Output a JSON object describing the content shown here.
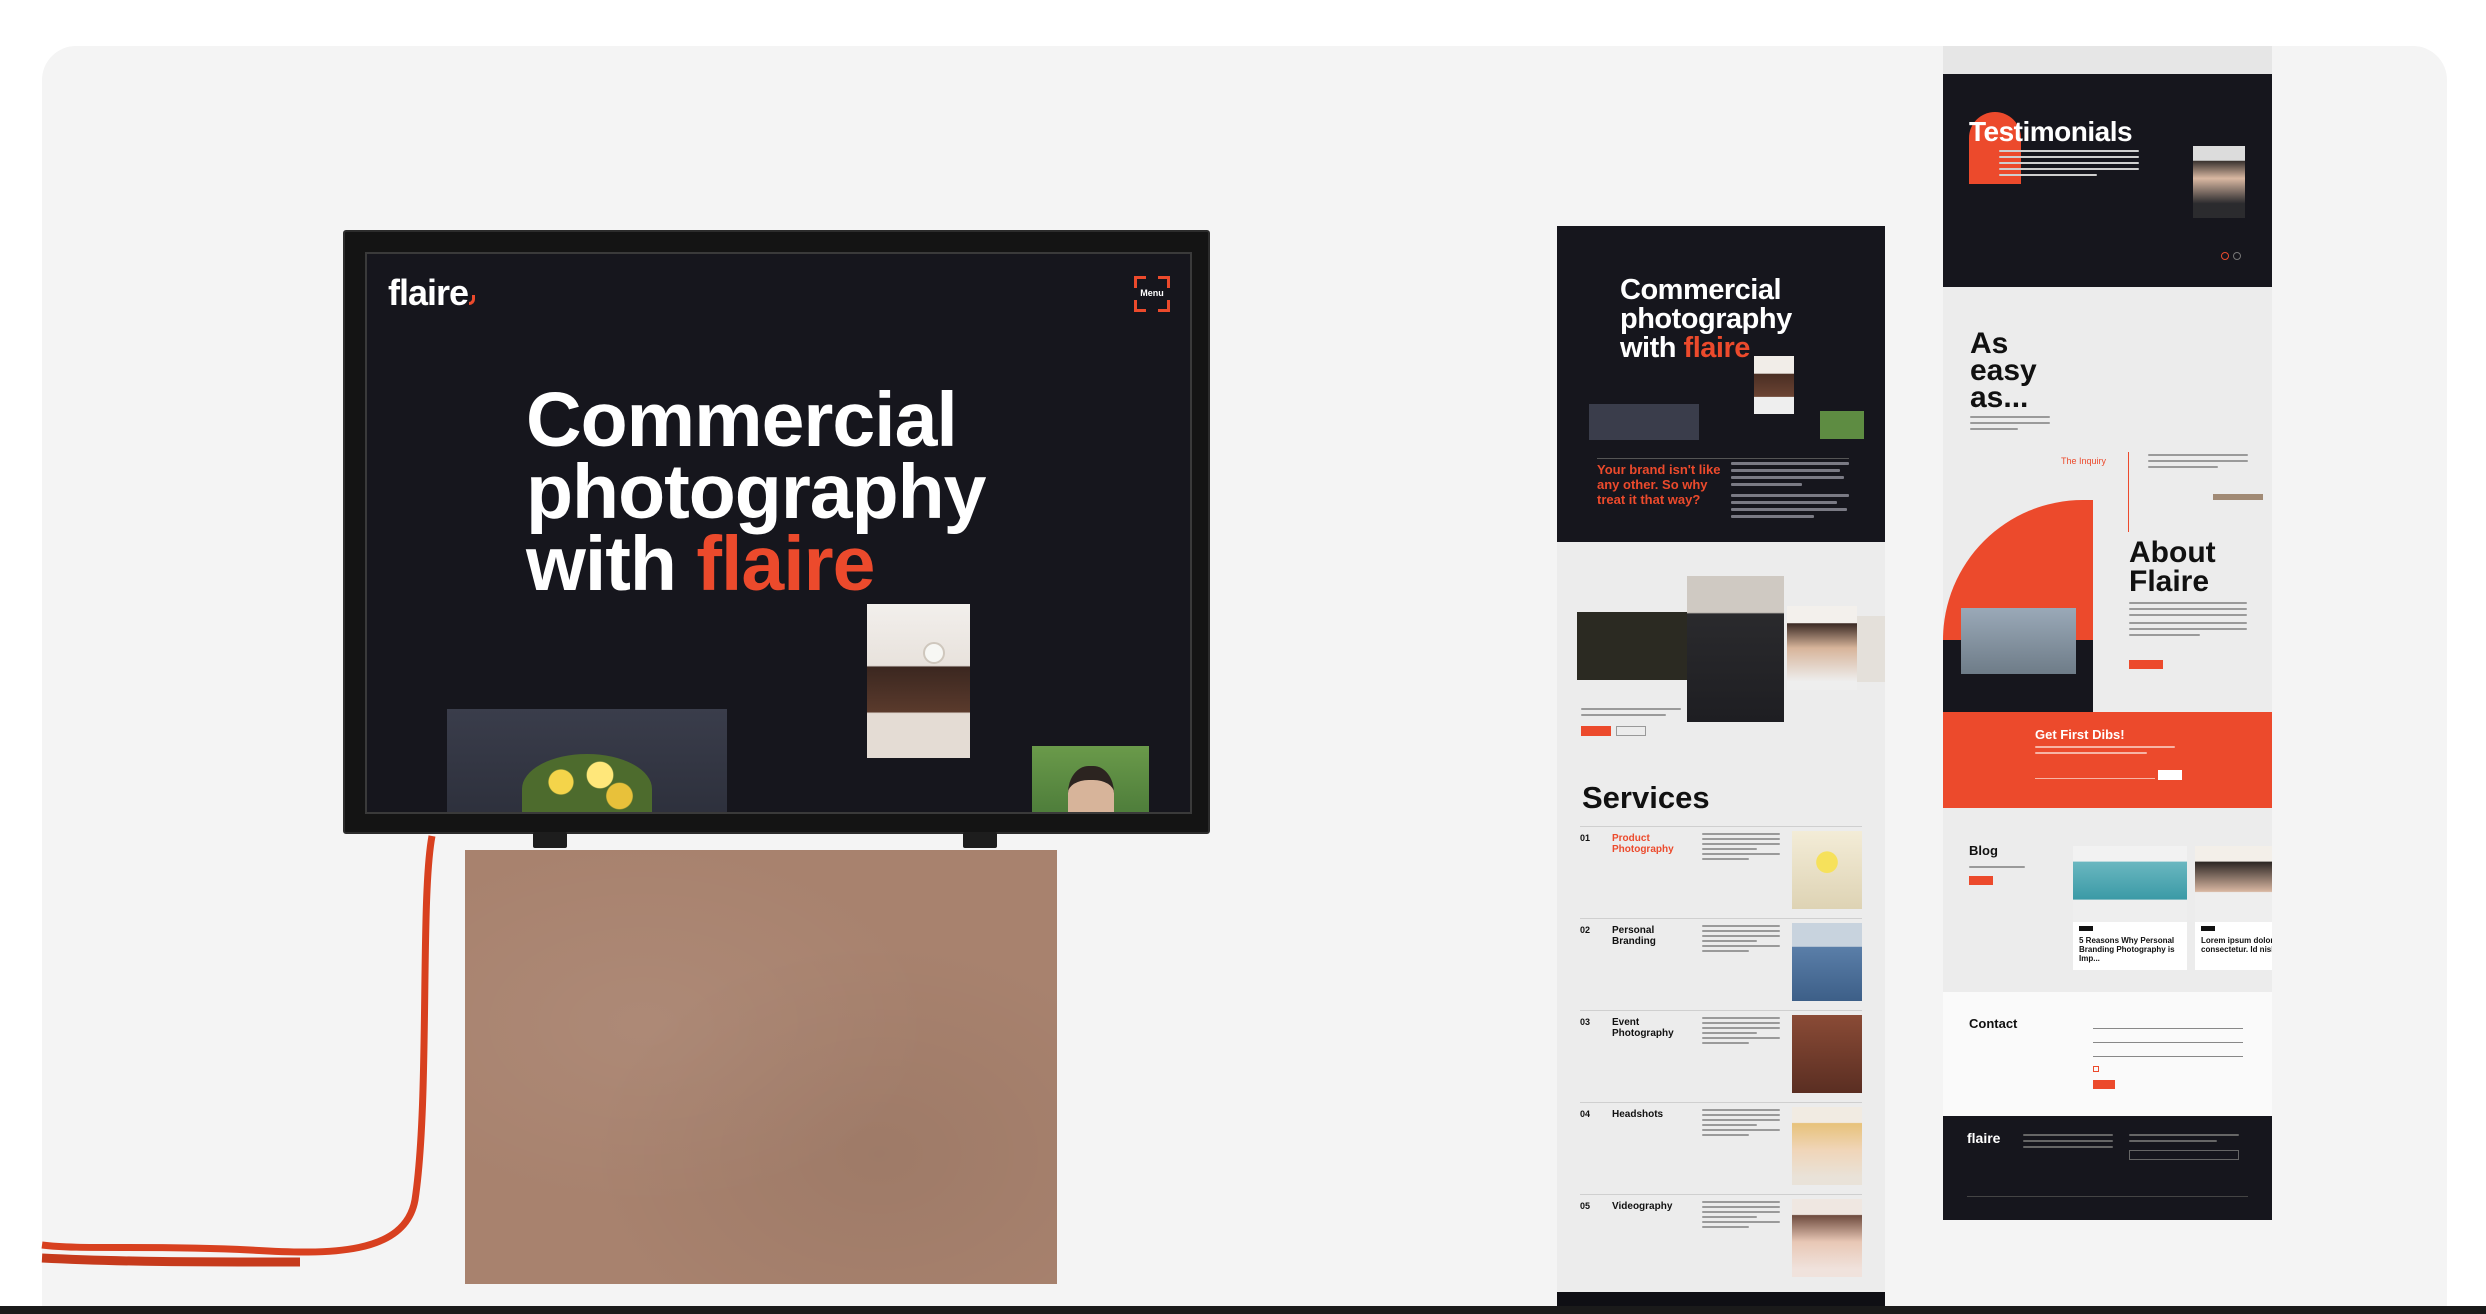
{
  "monitor": {
    "logo": "flaire",
    "menu_label": "Menu",
    "headline_line1": "Commercial",
    "headline_line2": "photography",
    "headline_prefix": "with ",
    "headline_accent": "flaire"
  },
  "mobile_mock": {
    "hero_line1": "Commercial",
    "hero_line2": "photography",
    "hero_prefix": "with ",
    "hero_accent": "flaire",
    "tagline": "Your brand isn't like any other. So why treat it that way?",
    "services_title": "Services",
    "services": [
      {
        "number": "01",
        "name": "Product Photography"
      },
      {
        "number": "02",
        "name": "Personal Branding"
      },
      {
        "number": "03",
        "name": "Event Photography"
      },
      {
        "number": "04",
        "name": "Headshots"
      },
      {
        "number": "05",
        "name": "Videography"
      }
    ]
  },
  "page_mock": {
    "testimonials_title": "Testimonials",
    "as_easy_as": [
      "As",
      "easy",
      "as..."
    ],
    "inquiry_label": "The Inquiry",
    "about_title": [
      "About",
      "Flaire"
    ],
    "dibs_title": "Get First Dibs!",
    "blog_title": "Blog",
    "blog_posts": [
      "5 Reasons Why Personal Branding Photography is Imp...",
      "Lorem ipsum dolor sit consectetur. Id nisl tel..."
    ],
    "contact_title": "Contact",
    "footer_logo": "flaire"
  },
  "colors": {
    "accent": "#ec4a2c",
    "dark": "#16161d",
    "pedestal": "#a8826e"
  }
}
